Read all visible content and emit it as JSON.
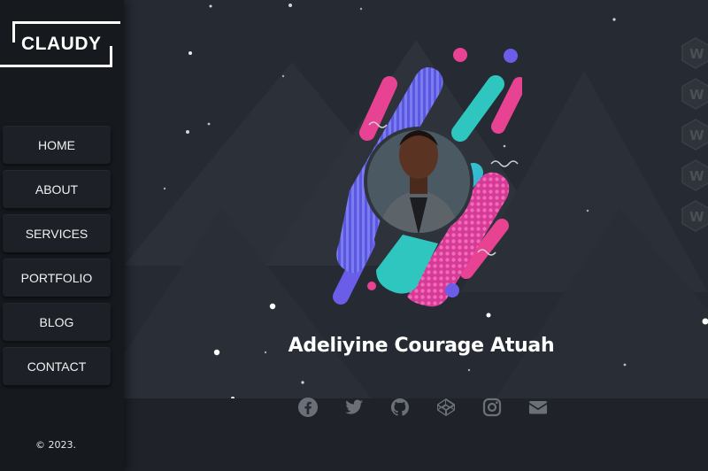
{
  "sidebar": {
    "logo": "CLAUDY",
    "nav": [
      {
        "label": "HOME"
      },
      {
        "label": "ABOUT"
      },
      {
        "label": "SERVICES"
      },
      {
        "label": "PORTFOLIO"
      },
      {
        "label": "BLOG"
      },
      {
        "label": "CONTACT"
      }
    ],
    "copyright": "© 2023."
  },
  "hero": {
    "name": "Adeliyine Courage Atuah"
  },
  "socials": [
    {
      "icon": "facebook-icon"
    },
    {
      "icon": "twitter-icon"
    },
    {
      "icon": "github-icon"
    },
    {
      "icon": "codepen-icon"
    },
    {
      "icon": "instagram-icon"
    },
    {
      "icon": "mail-icon"
    }
  ],
  "skills": [
    {
      "letter": "W"
    },
    {
      "letter": "W"
    },
    {
      "letter": "W"
    },
    {
      "letter": "W"
    },
    {
      "letter": "W"
    }
  ],
  "colors": {
    "background": "#262b33",
    "sidebar": "#16191e",
    "accent_pink": "#e84393",
    "accent_teal": "#2fc6c0",
    "accent_purple": "#6a5de8",
    "social_icon": "#6b7078"
  }
}
